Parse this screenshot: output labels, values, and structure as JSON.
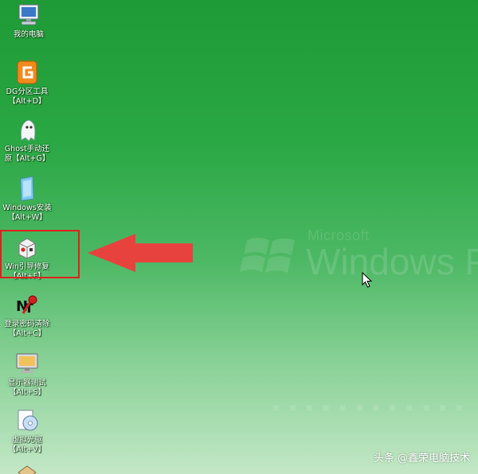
{
  "desktop": {
    "icons": [
      {
        "label": "我的电脑",
        "icon": "computer-icon"
      },
      {
        "label": "DG分区工具\n【Alt+D】",
        "icon": "diskgenius-icon"
      },
      {
        "label": "Ghost手动还\n原【Alt+G】",
        "icon": "ghost-icon"
      },
      {
        "label": "Windows安装\n【Alt+W】",
        "icon": "windows-install-icon"
      },
      {
        "label": "Win引导修复\n【Alt+F】",
        "icon": "boot-repair-icon"
      },
      {
        "label": "登录密码清除\n【Alt+C】",
        "icon": "password-clear-icon"
      },
      {
        "label": "显示器测试\n【Alt+S】",
        "icon": "monitor-test-icon"
      },
      {
        "label": "虚拟光驱\n【Alt+V】",
        "icon": "virtual-drive-icon"
      }
    ]
  },
  "watermark": {
    "small": "Microsoft",
    "big": "Windows PE"
  },
  "credit": "头条 @鑫荣电脑技术",
  "colors": {
    "highlight": "#e02020",
    "arrow": "#e8423f"
  }
}
